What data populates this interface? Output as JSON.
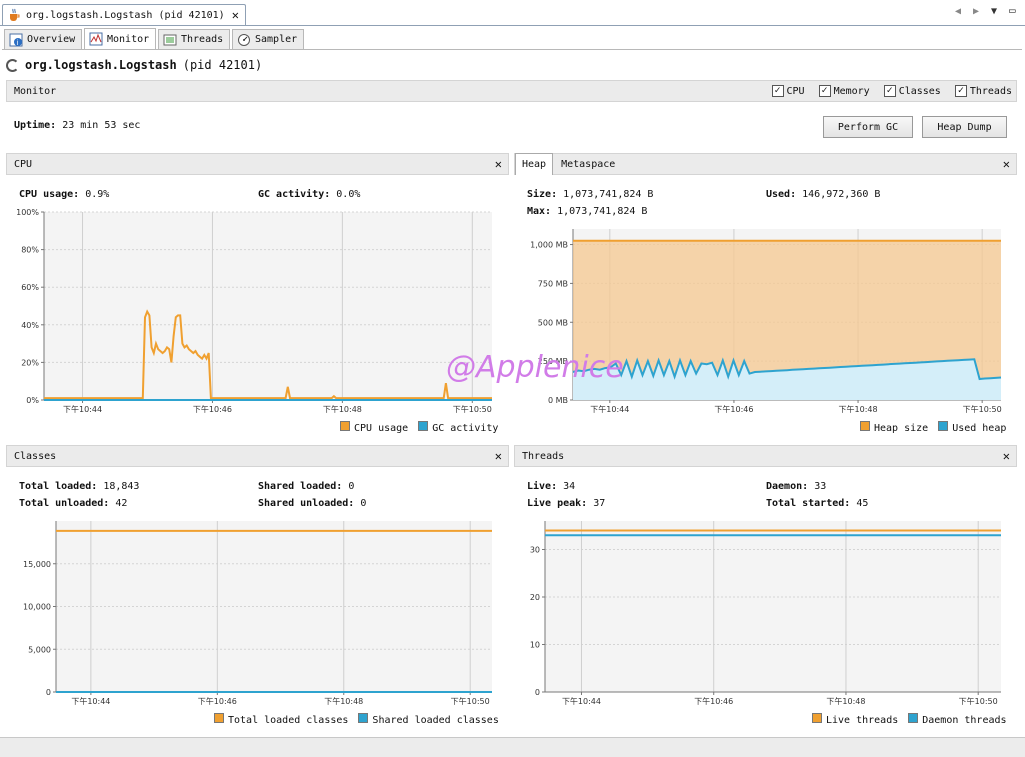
{
  "window": {
    "tab_title": "org.logstash.Logstash  (pid 42101)"
  },
  "subtabs": [
    {
      "label": "Overview"
    },
    {
      "label": "Monitor"
    },
    {
      "label": "Threads"
    },
    {
      "label": "Sampler"
    }
  ],
  "header": {
    "app": "org.logstash.Logstash",
    "pid": "(pid 42101)"
  },
  "monitor_bar": {
    "label": "Monitor",
    "checkboxes": [
      {
        "label": "CPU",
        "checked": true
      },
      {
        "label": "Memory",
        "checked": true
      },
      {
        "label": "Classes",
        "checked": true
      },
      {
        "label": "Threads",
        "checked": true
      }
    ]
  },
  "uptime": {
    "label": "Uptime:",
    "value": "23 min 53 sec"
  },
  "buttons": {
    "gc": "Perform GC",
    "dump": "Heap Dump"
  },
  "cpu_panel": {
    "title": "CPU",
    "usage_label": "CPU usage:",
    "usage_value": "0.9%",
    "gc_label": "GC activity:",
    "gc_value": "0.0%",
    "legend": [
      "CPU usage",
      "GC activity"
    ]
  },
  "heap_panel": {
    "tabs": [
      "Heap",
      "Metaspace"
    ],
    "size_label": "Size:",
    "size_value": "1,073,741,824 B",
    "used_label": "Used:",
    "used_value": "146,972,360 B",
    "max_label": "Max:",
    "max_value": "1,073,741,824 B",
    "legend": [
      "Heap size",
      "Used heap"
    ]
  },
  "classes_panel": {
    "title": "Classes",
    "total_loaded_label": "Total loaded:",
    "total_loaded_value": "18,843",
    "total_unloaded_label": "Total unloaded:",
    "total_unloaded_value": "42",
    "shared_loaded_label": "Shared loaded:",
    "shared_loaded_value": "0",
    "shared_unloaded_label": "Shared unloaded:",
    "shared_unloaded_value": "0",
    "legend": [
      "Total loaded classes",
      "Shared loaded classes"
    ]
  },
  "threads_panel": {
    "title": "Threads",
    "live_label": "Live:",
    "live_value": "34",
    "daemon_label": "Daemon:",
    "daemon_value": "33",
    "peak_label": "Live peak:",
    "peak_value": "37",
    "started_label": "Total started:",
    "started_value": "45",
    "legend": [
      "Live threads",
      "Daemon threads"
    ]
  },
  "colors": {
    "orange": "#f0a030",
    "blue": "#2ea3cf",
    "orange_fill": "#f6c890",
    "blue_fill": "#d4eef9"
  },
  "watermark": "@Applenice",
  "chart_data": [
    {
      "id": "cpu",
      "type": "line",
      "x_ticks": [
        "下午10:44",
        "下午10:46",
        "下午10:48",
        "下午10:50"
      ],
      "y_ticks": [
        "0%",
        "20%",
        "40%",
        "60%",
        "80%",
        "100%"
      ],
      "ylim": [
        0,
        100
      ],
      "series": [
        {
          "name": "CPU usage",
          "color": "#f0a030",
          "values": [
            1,
            1,
            1,
            1,
            1,
            1,
            1,
            1,
            1,
            1,
            1,
            1,
            1,
            1,
            1,
            1,
            1,
            1,
            1,
            1,
            1,
            1,
            1,
            1,
            1,
            1,
            1,
            1,
            1,
            1,
            1,
            1,
            1,
            1,
            1,
            1,
            1,
            1,
            1,
            1,
            1,
            1,
            1,
            1,
            1,
            1,
            44,
            47,
            45,
            28,
            25,
            30,
            27,
            26,
            25,
            26,
            28,
            27,
            20,
            34,
            44,
            45,
            45,
            30,
            28,
            29,
            27,
            26,
            25,
            26,
            24,
            23,
            22,
            24,
            22,
            25,
            1,
            1,
            1,
            1,
            1,
            1,
            1,
            1,
            1,
            1,
            1,
            1,
            1,
            1,
            1,
            1,
            1,
            1,
            1,
            1,
            1,
            1,
            1,
            1,
            1,
            1,
            1,
            1,
            1,
            1,
            1,
            1,
            1,
            1,
            1,
            7,
            1,
            1,
            1,
            1,
            1,
            1,
            1,
            1,
            1,
            1,
            1,
            1,
            1,
            1,
            1,
            1,
            1,
            1,
            1,
            1,
            2,
            1,
            1,
            1,
            1,
            1,
            1,
            1,
            1,
            1,
            1,
            1,
            1,
            1,
            1,
            1,
            1,
            1,
            1,
            1,
            1,
            1,
            1,
            1,
            1,
            1,
            1,
            1,
            1,
            1,
            1,
            1,
            1,
            1,
            1,
            1,
            1,
            1,
            1,
            1,
            1,
            1,
            1,
            1,
            1,
            1,
            1,
            1,
            1,
            1,
            1,
            9,
            1,
            1,
            1,
            1,
            1,
            1,
            1,
            1,
            1,
            1,
            1,
            1,
            1,
            1,
            1,
            1,
            1,
            1,
            1,
            1,
            1
          ]
        },
        {
          "name": "GC activity",
          "color": "#2ea3cf",
          "values": [
            0
          ]
        }
      ]
    },
    {
      "id": "heap",
      "type": "area",
      "x_ticks": [
        "下午10:44",
        "下午10:46",
        "下午10:48",
        "下午10:50"
      ],
      "y_ticks": [
        "0 MB",
        "250 MB",
        "500 MB",
        "750 MB",
        "1,000 MB"
      ],
      "ylim": [
        0,
        1100
      ],
      "series": [
        {
          "name": "Heap size",
          "color": "#f0a030",
          "values": [
            1024
          ]
        },
        {
          "name": "Used heap",
          "color": "#2ea3cf",
          "values": [
            180,
            190,
            185,
            195,
            200,
            195,
            205,
            210,
            235,
            160,
            250,
            150,
            255,
            160,
            250,
            155,
            255,
            160,
            250,
            150,
            255,
            160,
            250,
            170,
            235,
            230,
            240,
            160,
            255,
            150,
            255,
            160,
            250,
            170,
            180,
            182,
            184,
            186,
            188,
            190,
            192,
            194,
            196,
            198,
            200,
            202,
            204,
            206,
            208,
            210,
            212,
            214,
            216,
            218,
            220,
            222,
            224,
            226,
            228,
            230,
            232,
            234,
            236,
            238,
            240,
            242,
            244,
            246,
            248,
            250,
            252,
            254,
            256,
            258,
            260,
            262,
            135,
            138,
            140,
            142,
            145
          ]
        }
      ]
    },
    {
      "id": "classes",
      "type": "line",
      "x_ticks": [
        "下午10:44",
        "下午10:46",
        "下午10:48",
        "下午10:50"
      ],
      "y_ticks": [
        "0",
        "5,000",
        "10,000",
        "15,000"
      ],
      "ylim": [
        0,
        20000
      ],
      "series": [
        {
          "name": "Total loaded classes",
          "color": "#f0a030",
          "values": [
            18843
          ]
        },
        {
          "name": "Shared loaded classes",
          "color": "#2ea3cf",
          "values": [
            0
          ]
        }
      ]
    },
    {
      "id": "threads",
      "type": "line",
      "x_ticks": [
        "下午10:44",
        "下午10:46",
        "下午10:48",
        "下午10:50"
      ],
      "y_ticks": [
        "0",
        "10",
        "20",
        "30"
      ],
      "ylim": [
        0,
        36
      ],
      "series": [
        {
          "name": "Live threads",
          "color": "#f0a030",
          "values": [
            34
          ]
        },
        {
          "name": "Daemon threads",
          "color": "#2ea3cf",
          "values": [
            33
          ]
        }
      ]
    }
  ]
}
